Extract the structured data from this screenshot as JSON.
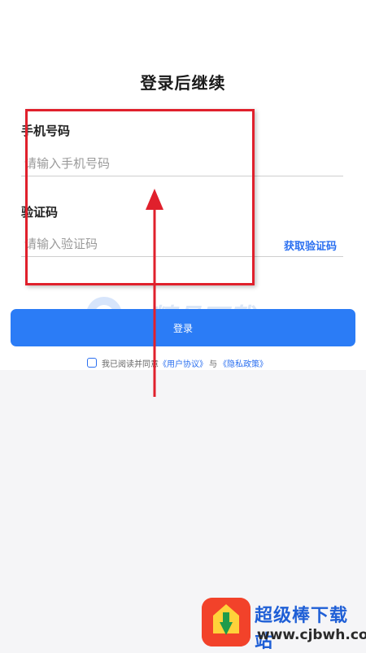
{
  "header": {
    "title": "登录后继续"
  },
  "form": {
    "phone_label": "手机号码",
    "phone_placeholder": "请输入手机号码",
    "code_label": "验证码",
    "code_placeholder": "请输入验证码",
    "get_code_label": "获取验证码",
    "login_label": "登录"
  },
  "agreement": {
    "prefix": "我已阅读并同意",
    "user_agreement": "《用户协议》",
    "and": "与",
    "privacy_policy": "《隐私政策》"
  },
  "watermarks": {
    "center_text": "精品下载",
    "brand_name": "超级棒下载站",
    "brand_url": "www.cjbwh.com"
  },
  "colors": {
    "accent": "#2b7cf6",
    "link": "#2a6ff0",
    "annotation": "#e0202c",
    "background": "#f5f5f7"
  },
  "icons": {
    "checkbox": "checkbox-icon",
    "arrow": "annotation-arrow-icon",
    "brand_logo": "brand-logo-icon"
  }
}
